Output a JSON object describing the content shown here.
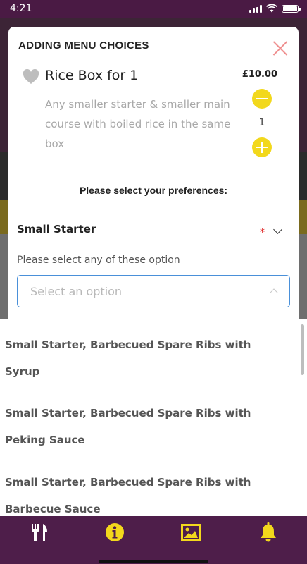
{
  "status_bar": {
    "time": "4:21"
  },
  "modal": {
    "title": "ADDING MENU CHOICES",
    "item": {
      "name": "Rice Box for 1",
      "price": "£10.00",
      "description": "Any smaller starter & smaller main course with boiled rice in the same box",
      "quantity": "1"
    },
    "preferences_heading": "Please select your preferences:",
    "section": {
      "title": "Small Starter",
      "required_mark": "*",
      "helper": "Please select any of these option",
      "select_placeholder": "Select an option"
    }
  },
  "dropdown": {
    "options": [
      "Small Starter, Barbecued Spare Ribs with Syrup",
      "Small Starter, Barbecued Spare Ribs with Peking Sauce",
      "Small Starter, Barbecued Spare Ribs with Barbecue Sauce"
    ]
  },
  "bottom_nav": {
    "items": [
      {
        "icon": "fork-knife-icon"
      },
      {
        "icon": "info-icon"
      },
      {
        "icon": "gallery-icon"
      },
      {
        "icon": "bell-icon"
      }
    ]
  },
  "colors": {
    "brand_purple": "#4e1e4a",
    "accent_yellow": "#f2d81c",
    "close_pink": "#ef8f8f",
    "required_red": "#e02424",
    "focus_blue": "#4a90d9"
  }
}
